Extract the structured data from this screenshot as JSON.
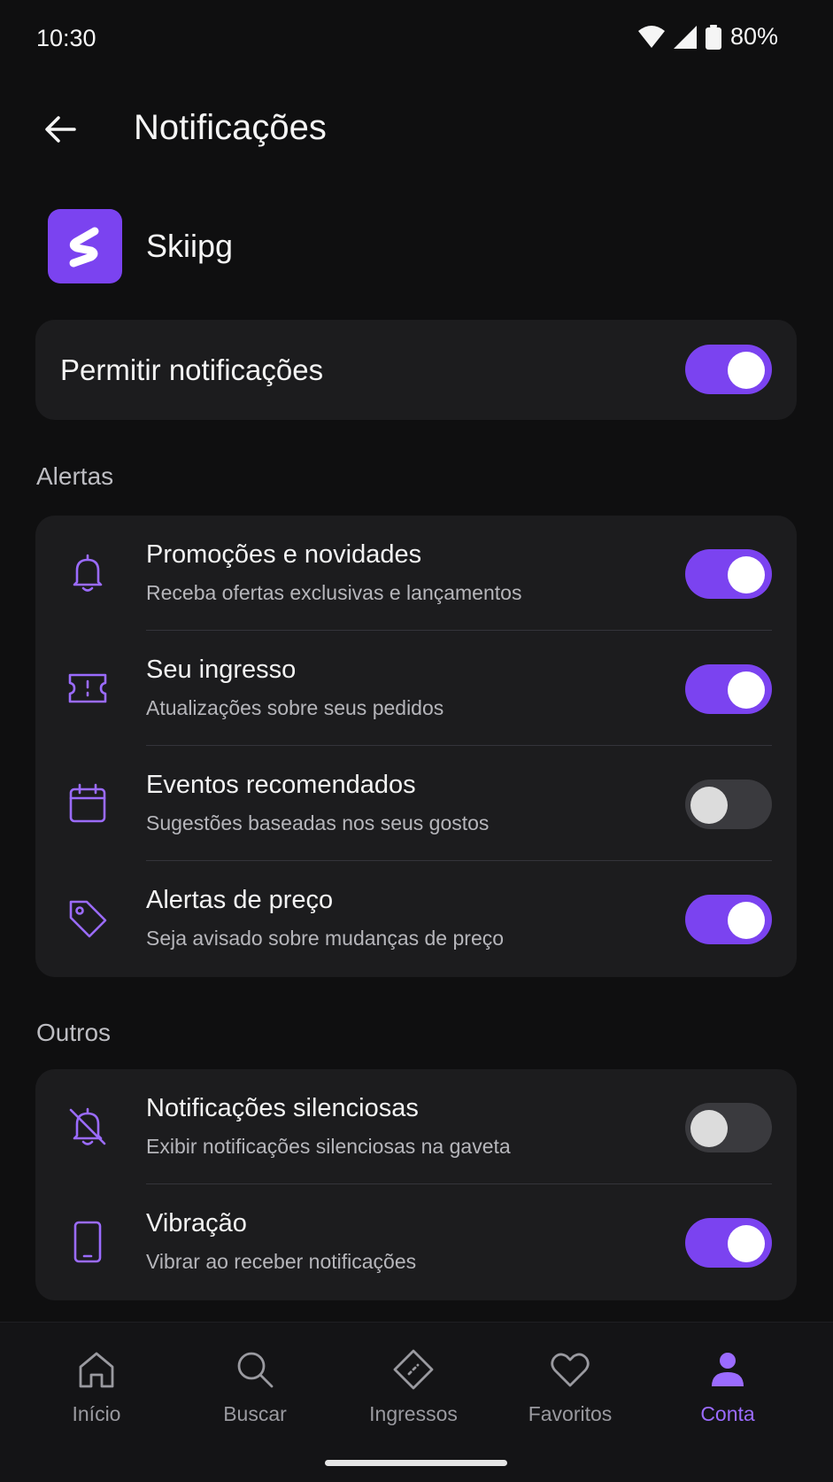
{
  "status_bar": {
    "time": "10:30",
    "battery": "80%"
  },
  "app_bar": {
    "title": "Notificações"
  },
  "app": {
    "name": "Skiipg"
  },
  "allow": {
    "label": "Permitir notificações",
    "enabled": true
  },
  "sections": {
    "alerts": {
      "label": "Alertas",
      "items": [
        {
          "title": "Promoções e novidades",
          "subtitle": "Receba ofertas exclusivas e lançamentos",
          "icon": "bell-icon",
          "enabled": true
        },
        {
          "title": "Seu ingresso",
          "subtitle": "Atualizações sobre seus pedidos",
          "icon": "ticket-icon",
          "enabled": true
        },
        {
          "title": "Eventos recomendados",
          "subtitle": "Sugestões baseadas nos seus gostos",
          "icon": "calendar-icon",
          "enabled": false
        },
        {
          "title": "Alertas de preço",
          "subtitle": "Seja avisado sobre mudanças de preço",
          "icon": "tag-icon",
          "enabled": true
        }
      ]
    },
    "others": {
      "label": "Outros",
      "items": [
        {
          "title": "Notificações silenciosas",
          "subtitle": "Exibir notificações silenciosas na gaveta",
          "icon": "bell-off-icon",
          "enabled": false
        },
        {
          "title": "Vibração",
          "subtitle": "Vibrar ao receber notificações",
          "icon": "phone-icon",
          "enabled": true
        }
      ]
    }
  },
  "bottom_nav": {
    "items": [
      {
        "label": "Início",
        "icon": "home-icon",
        "active": false
      },
      {
        "label": "Buscar",
        "icon": "search-icon",
        "active": false
      },
      {
        "label": "Ingressos",
        "icon": "ticket-icon",
        "active": false
      },
      {
        "label": "Favoritos",
        "icon": "heart-icon",
        "active": false
      },
      {
        "label": "Conta",
        "icon": "person-icon",
        "active": true
      }
    ]
  },
  "colors": {
    "accent": "#7b43f0",
    "accent_text": "#9b6bff",
    "background": "#0f0f10",
    "card": "#1c1c1e"
  }
}
